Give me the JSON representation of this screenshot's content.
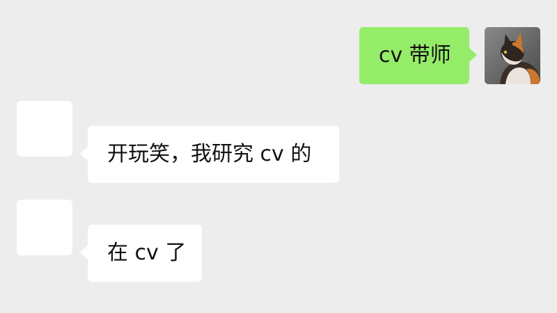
{
  "conversation": {
    "messages": [
      {
        "sender": "self",
        "text": "cv 带师",
        "avatar_icon": "cat-photo-avatar"
      },
      {
        "sender": "other",
        "text": "开玩笑，我研究 cv 的",
        "avatar_icon": "blank-avatar"
      },
      {
        "sender": "other",
        "text": "在 cv 了",
        "avatar_icon": "blank-avatar"
      }
    ]
  },
  "colors": {
    "background": "#ededed",
    "self_bubble": "#95ec69",
    "other_bubble": "#ffffff",
    "text": "#111111"
  }
}
